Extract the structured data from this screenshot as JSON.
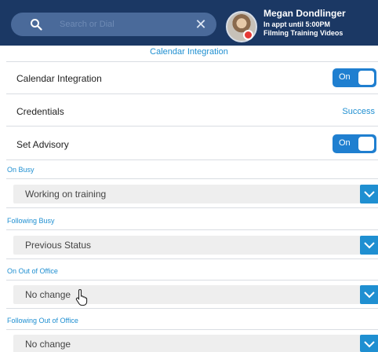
{
  "header": {
    "search": {
      "placeholder": "Search or Dial"
    },
    "user": {
      "name": "Megan Dondlinger",
      "status": "In appt until 5:00PM",
      "activity": "Filming Training Videos"
    }
  },
  "page": {
    "title": "Calendar Integration"
  },
  "settings": {
    "calendar_integration": {
      "label": "Calendar Integration",
      "toggle": "On"
    },
    "credentials": {
      "label": "Credentials",
      "value": "Success"
    },
    "set_advisory": {
      "label": "Set Advisory",
      "toggle": "On"
    }
  },
  "advisory": [
    {
      "label": "On Busy",
      "value": "Working on training"
    },
    {
      "label": "Following Busy",
      "value": "Previous Status"
    },
    {
      "label": "On Out of Office",
      "value": "No change"
    },
    {
      "label": "Following Out of Office",
      "value": "No change"
    }
  ],
  "icons": {
    "search": "search-icon",
    "clear": "close-icon",
    "dropdown": "chevron-down-icon",
    "cursor": "hand-cursor-icon"
  },
  "colors": {
    "header_bg": "#1b3864",
    "accent": "#1f8fd1",
    "presence_busy": "#e53935"
  }
}
